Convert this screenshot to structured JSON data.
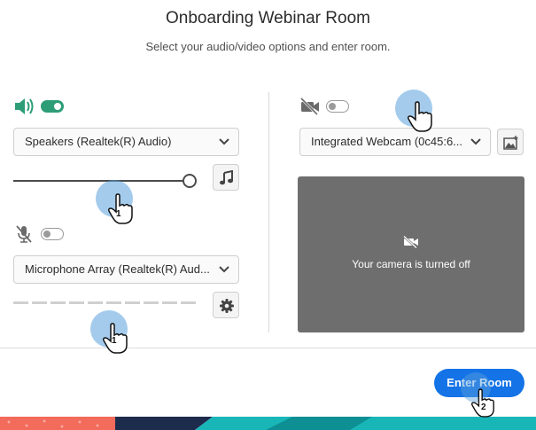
{
  "header": {
    "title": "Onboarding Webinar Room",
    "subtitle": "Select your audio/video options and enter room."
  },
  "audio": {
    "speaker_icon": "speaker-volume-icon",
    "speaker_toggle": "on",
    "speaker_select": "Speakers (Realtek(R) Audio)",
    "volume_fraction": 1.0,
    "test_sound_icon": "music-note-icon",
    "mic_icon": "microphone-muted-icon",
    "mic_toggle": "off",
    "mic_select": "Microphone Array (Realtek(R) Aud...",
    "mic_level_fraction": 0.0,
    "mic_settings_icon": "gear-icon"
  },
  "video": {
    "camera_icon": "camera-off-icon",
    "camera_toggle": "off",
    "camera_select": "Integrated Webcam (0c45:6...",
    "background_icon": "background-effects-icon",
    "preview_text": "Your camera is turned off"
  },
  "footer": {
    "enter_label": "Enter Room"
  },
  "annotations": {
    "cursor_1_a": "1",
    "cursor_1_b": "1",
    "cursor_enter": "2"
  },
  "colors": {
    "accent": "#1473e6",
    "toggle_on": "#2d9d78",
    "preview_bg": "#6e6e6e"
  }
}
